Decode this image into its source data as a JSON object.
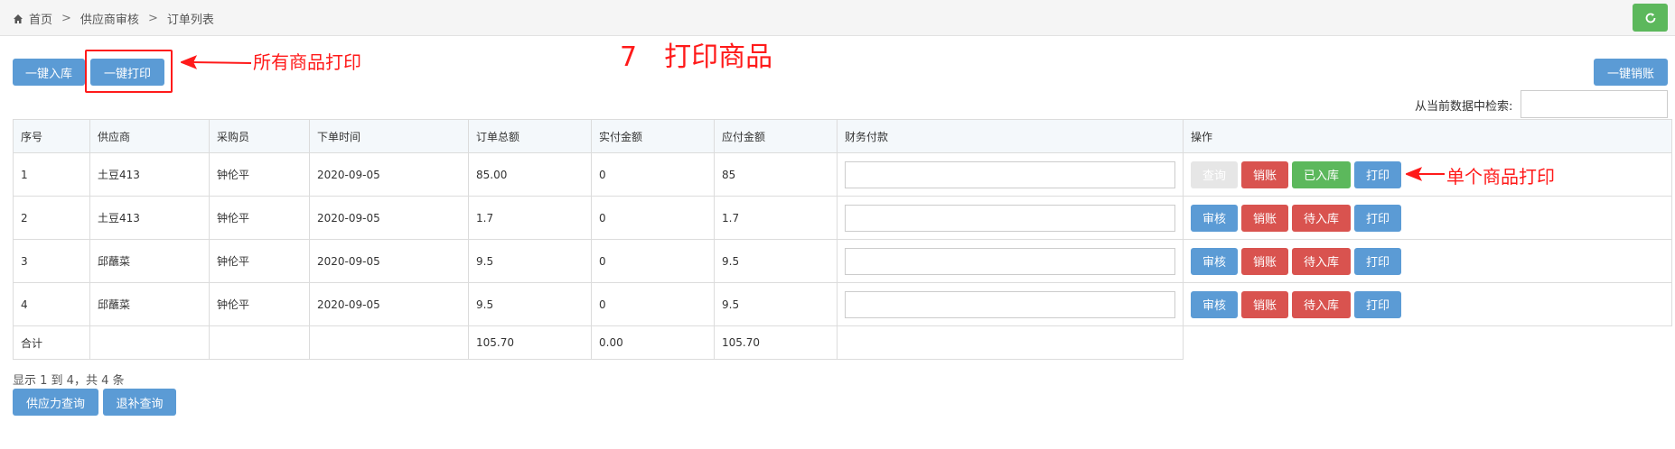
{
  "breadcrumb": {
    "home": "首页",
    "level2": "供应商审核",
    "level3": "订单列表"
  },
  "buttons": {
    "batch_stock_in": "一键入库",
    "batch_print": "一键打印",
    "batch_writeoff": "一键销账",
    "supply_query": "供应力查询",
    "refund_query": "退补查询"
  },
  "annotations": {
    "all_print": "所有商品打印",
    "step_title": "7　打印商品",
    "single_print": "单个商品打印"
  },
  "search": {
    "label": "从当前数据中检索:",
    "value": ""
  },
  "table": {
    "headers": [
      "序号",
      "供应商",
      "采购员",
      "下单时间",
      "订单总额",
      "实付金额",
      "应付金额",
      "财务付款",
      "操作"
    ],
    "rows": [
      {
        "no": "1",
        "supplier": "土豆413",
        "buyer": "钟伦平",
        "date": "2020-09-05",
        "total": "85.00",
        "paid": "0",
        "payable": "85",
        "ops": [
          "查询",
          "销账",
          "已入库",
          "打印"
        ]
      },
      {
        "no": "2",
        "supplier": "土豆413",
        "buyer": "钟伦平",
        "date": "2020-09-05",
        "total": "1.7",
        "paid": "0",
        "payable": "1.7",
        "ops": [
          "审核",
          "销账",
          "待入库",
          "打印"
        ]
      },
      {
        "no": "3",
        "supplier": "邱蘸菜",
        "buyer": "钟伦平",
        "date": "2020-09-05",
        "total": "9.5",
        "paid": "0",
        "payable": "9.5",
        "ops": [
          "审核",
          "销账",
          "待入库",
          "打印"
        ]
      },
      {
        "no": "4",
        "supplier": "邱蘸菜",
        "buyer": "钟伦平",
        "date": "2020-09-05",
        "total": "9.5",
        "paid": "0",
        "payable": "9.5",
        "ops": [
          "审核",
          "销账",
          "待入库",
          "打印"
        ]
      }
    ],
    "total_row": {
      "label": "合计",
      "total": "105.70",
      "paid": "0.00",
      "payable": "105.70"
    }
  },
  "pagination_text": "显示 1 到 4，共 4 条",
  "icons": {
    "home": "home-icon",
    "refresh": "refresh-icon"
  },
  "colors": {
    "primary": "#5b9bd5",
    "danger": "#d9534f",
    "success": "#5cb85c",
    "annotation": "#ff1a1a"
  }
}
